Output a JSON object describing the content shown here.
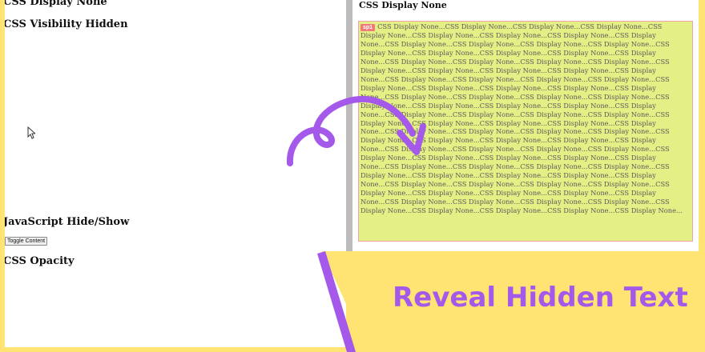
{
  "left_panel": {
    "heading_display_none": "CSS Display None",
    "heading_visibility_hidden": "CSS Visibility Hidden",
    "heading_js_hide_show": "JavaScript Hide/Show",
    "toggle_button_label": "Toggle Content",
    "heading_opacity": "CSS Opacity"
  },
  "right_panel": {
    "title": "CSS Display None",
    "badge_text": "sp1",
    "repeated_text": "CSS Display None...",
    "repeat_count": 99
  },
  "banner": {
    "text": "Reveal Hidden Text"
  },
  "colors": {
    "background_yellow": "#ffe373",
    "accent_purple": "#a559ea",
    "highlight_box": "#e4ef86",
    "badge_red": "#f07a7a"
  },
  "icons": [
    "mouse-pointer-icon",
    "curly-arrow-icon"
  ]
}
